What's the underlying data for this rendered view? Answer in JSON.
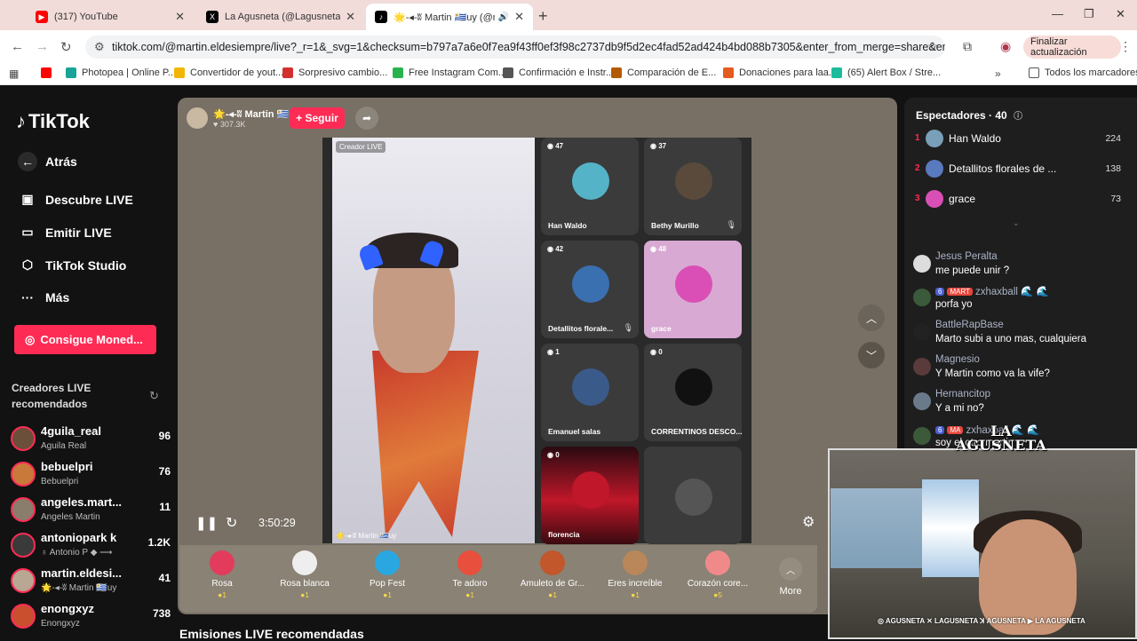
{
  "browser": {
    "tabs": [
      {
        "title": "(317) YouTube",
        "icon": "youtube-icon",
        "color": "#ff0000"
      },
      {
        "title": "La Agusneta (@Lagusneta) / X",
        "icon": "x-icon",
        "color": "#000000"
      },
      {
        "title": "🌟-◂-ʬ Martin 🇺🇾uy (@mar",
        "icon": "tiktok-icon",
        "color": "#000000"
      }
    ],
    "url": "tiktok.com/@martin.eldesiempre/live?_r=1&_svg=1&checksum=b797a7a6e0f7ea9f43ff0ef3f98c2737db9f5d2ec4fad52ad424b4bd088b7305&enter_from_merge=share&enter_method...",
    "update_button": "Finalizar actualización",
    "bookmarks": [
      {
        "label": "",
        "color": "#ff0000"
      },
      {
        "label": "Photopea | Online P...",
        "color": "#18a497"
      },
      {
        "label": "Convertidor de yout...",
        "color": "#f2b600"
      },
      {
        "label": "Sorpresivo cambio...",
        "color": "#d32f2f"
      },
      {
        "label": "Free Instagram Com...",
        "color": "#2ab24f"
      },
      {
        "label": "Confirmación e Instr...",
        "color": "#555555"
      },
      {
        "label": "Comparación de E...",
        "color": "#b35900"
      },
      {
        "label": "Donaciones para laa...",
        "color": "#e55a1f"
      },
      {
        "label": "(65) Alert Box / Stre...",
        "color": "#1abc9c"
      }
    ],
    "all_bookmarks": "Todos los marcadores"
  },
  "sidebar": {
    "logo": "TikTok",
    "nav": [
      {
        "label": "Atrás",
        "icon": "back-arrow-icon"
      },
      {
        "label": "Descubre LIVE",
        "icon": "live-tv-icon"
      },
      {
        "label": "Emitir LIVE",
        "icon": "video-camera-icon"
      },
      {
        "label": "TikTok Studio",
        "icon": "studio-icon"
      },
      {
        "label": "Más",
        "icon": "more-dots-icon"
      }
    ],
    "coins_button": "Consigue Moned...",
    "recommended_title": "Creadores LIVE recomendados",
    "creators": [
      {
        "username": "4guila_real",
        "display": "Aguila Real",
        "viewers": "96",
        "color": "#6b4f3a"
      },
      {
        "username": "bebuelpri",
        "display": "Bebuelpri",
        "viewers": "76",
        "color": "#c97a3a"
      },
      {
        "username": "angeles.mart...",
        "display": "Angeles Martin",
        "viewers": "11",
        "color": "#8a7d6c"
      },
      {
        "username": "antoniopark k",
        "display": "♁ Antonio P ◆ ⟶",
        "viewers": "1.2K",
        "color": "#3a3a3a"
      },
      {
        "username": "martin.eldesi...",
        "display": "🌟-◂-ʬ Martin 🇺🇾uy",
        "viewers": "41",
        "color": "#b9a793"
      },
      {
        "username": "enongxyz",
        "display": "Enongxyz",
        "viewers": "738",
        "color": "#c94f2f"
      }
    ]
  },
  "live": {
    "host_name": "🌟-◂-ʬ Martin 🇺🇾uy",
    "host_likes": "♥ 307.3K",
    "follow_button": "+ Seguir",
    "creator_label": "Creador LIVE",
    "host_video_name": "🌟-◂-ʬ Martin 🇺🇾uy",
    "time": "3:50:29",
    "guests": [
      {
        "name": "Han Waldo",
        "count": "47",
        "color": "#55b3c8",
        "muted": false
      },
      {
        "name": "Bethy Murillo",
        "count": "37",
        "color": "#5a4a3c",
        "muted": true
      },
      {
        "name": "Detallitos florale...",
        "count": "42",
        "color": "#3a6fb0",
        "muted": true
      },
      {
        "name": "grace",
        "count": "48",
        "color": "#d94fb5",
        "muted": false
      },
      {
        "name": "Emanuel salas",
        "count": "1",
        "color": "#3a5a8a",
        "muted": false
      },
      {
        "name": "CORRENTINOS DESCO...",
        "count": "0",
        "color": "#111111",
        "muted": false
      },
      {
        "name": "florencia",
        "count": "0",
        "color": "#c0172a",
        "muted": false
      },
      {
        "name": "",
        "count": "",
        "color": "#3b3b3b",
        "muted": false
      }
    ],
    "gifts": [
      {
        "name": "Rosa",
        "price": "●1",
        "color": "#e23b5b"
      },
      {
        "name": "Rosa blanca",
        "price": "●1",
        "color": "#eeeeee"
      },
      {
        "name": "Pop Fest",
        "price": "●1",
        "color": "#2aa7e0"
      },
      {
        "name": "Te adoro",
        "price": "●1",
        "color": "#e84f3d"
      },
      {
        "name": "Amuleto de Gr...",
        "price": "●1",
        "color": "#c1572b"
      },
      {
        "name": "Eres increíble",
        "price": "●1",
        "color": "#b9875a"
      },
      {
        "name": "Corazón core...",
        "price": "●5",
        "color": "#f08a8a"
      }
    ],
    "more_label": "More",
    "recommended_live": "Emisiones LIVE recomendadas"
  },
  "spectators": {
    "title": "Espectadores · 40",
    "top": [
      {
        "rank": "1",
        "name": "Han Waldo",
        "score": "224",
        "color": "#7a9fb8"
      },
      {
        "rank": "2",
        "name": "Detallitos florales de ...",
        "score": "138",
        "color": "#5a7ac0"
      },
      {
        "rank": "3",
        "name": "grace",
        "score": "73",
        "color": "#d94fb5"
      }
    ]
  },
  "chat": [
    {
      "user": "Jesus Peralta",
      "msg": "me puede unir ?",
      "color": "#dddddd",
      "badges": []
    },
    {
      "user": "zxhaxball 🌊 🌊",
      "msg": "porfa yo",
      "color": "#3a5a3a",
      "badges": [
        "6",
        "MART"
      ]
    },
    {
      "user": "BattleRapBase",
      "msg": "Marto subi a uno mas, cualquiera",
      "color": "#222222",
      "badges": []
    },
    {
      "user": "Magnesio",
      "msg": "Y Martin como va la vife?",
      "color": "#5a3a3a",
      "badges": []
    },
    {
      "user": "Hernancitop",
      "msg": "Y a mi no?",
      "color": "#6a7a8a",
      "badges": []
    },
    {
      "user": "zxhaxball 🌊 🌊",
      "msg": "soy el otro martin",
      "color": "#3a5a3a",
      "badges": [
        "6",
        "MA"
      ]
    }
  ],
  "cam": {
    "logo_line1": "LA",
    "logo_line2": "AGUSNETA",
    "footer": "◎ AGUSNETA  ✕ LAGUSNETA  ꓘ AGUSNETA  ▶ LA AGUSNETA"
  }
}
